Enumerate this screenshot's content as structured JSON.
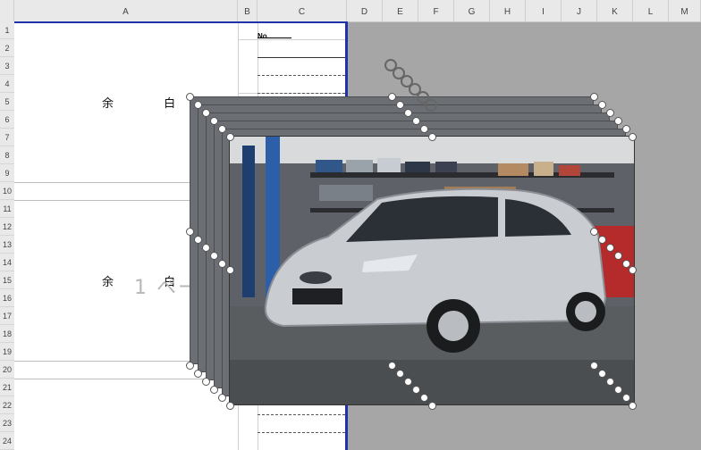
{
  "columns": [
    "A",
    "B",
    "C",
    "D",
    "E",
    "F",
    "G",
    "H",
    "I",
    "J",
    "K",
    "L",
    "M"
  ],
  "rows": [
    "1",
    "2",
    "3",
    "4",
    "5",
    "6",
    "7",
    "8",
    "9",
    "10",
    "11",
    "12",
    "13",
    "14",
    "15",
    "16",
    "17",
    "18",
    "19",
    "20",
    "21",
    "22",
    "23",
    "24"
  ],
  "sheet": {
    "no_label": "No.",
    "blank_label_1": "余 白",
    "blank_label_2": "余 白",
    "page_watermark": "1 ペー"
  },
  "image": {
    "subject": "silver hatchback car in a garage"
  },
  "colors": {
    "page_border": "#2233aa",
    "background": "#a6a6a6",
    "car_body": "#c9ccd1"
  }
}
